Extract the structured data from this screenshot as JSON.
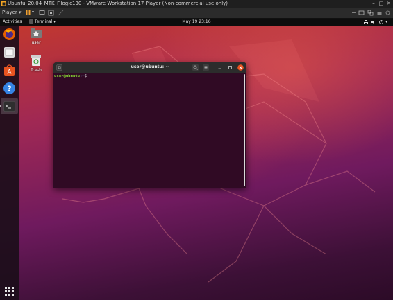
{
  "vmware": {
    "window_title": "Ubuntu_20.04_MTK_Filogic130 - VMware Workstation 17 Player (Non-commercial use only)",
    "player_menu": "Player",
    "win_minimize": "–",
    "win_restore": "□",
    "win_close": "✕"
  },
  "gnome": {
    "activities": "Activities",
    "app_menu": "Terminal ▾",
    "clock": "May 19  23:16"
  },
  "desktop_icons": [
    {
      "label": "user"
    },
    {
      "label": "Trash"
    }
  ],
  "terminal": {
    "title": "user@ubuntu: ~",
    "prompt_user_host": "user@ubuntu",
    "prompt_path": ":~",
    "prompt_symbol": "$"
  },
  "colors": {
    "prompt_green": "#8ae234",
    "prompt_blue": "#729fcf",
    "terminal_bg": "#300a24",
    "close_orange": "#e95420"
  }
}
